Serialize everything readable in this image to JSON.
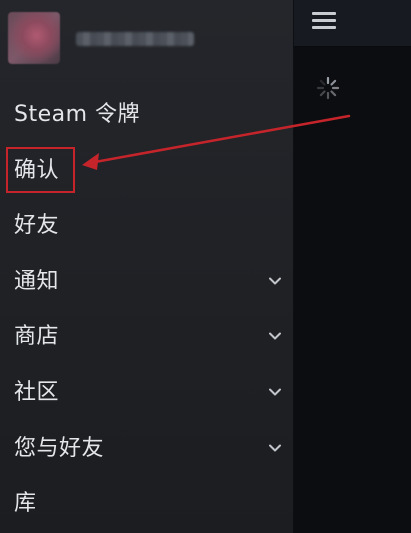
{
  "header": {
    "menu_icon": "hamburger-icon",
    "loading_icon": "loading-spinner-icon"
  },
  "profile": {
    "avatar_icon": "avatar-pixelated",
    "username_obscured": true
  },
  "menu": {
    "items": [
      {
        "label": "Steam 令牌",
        "has_submenu": false
      },
      {
        "label": "确认",
        "has_submenu": false,
        "highlighted": true
      },
      {
        "label": "好友",
        "has_submenu": false
      },
      {
        "label": "通知",
        "has_submenu": true
      },
      {
        "label": "商店",
        "has_submenu": true
      },
      {
        "label": "社区",
        "has_submenu": true
      },
      {
        "label": "您与好友",
        "has_submenu": true
      },
      {
        "label": "库",
        "has_submenu": false
      }
    ]
  },
  "colors": {
    "drawer_bg": "#1f2125",
    "text": "#e4e6ea",
    "annotation": "#c6242b",
    "topbar": "#171a21"
  }
}
